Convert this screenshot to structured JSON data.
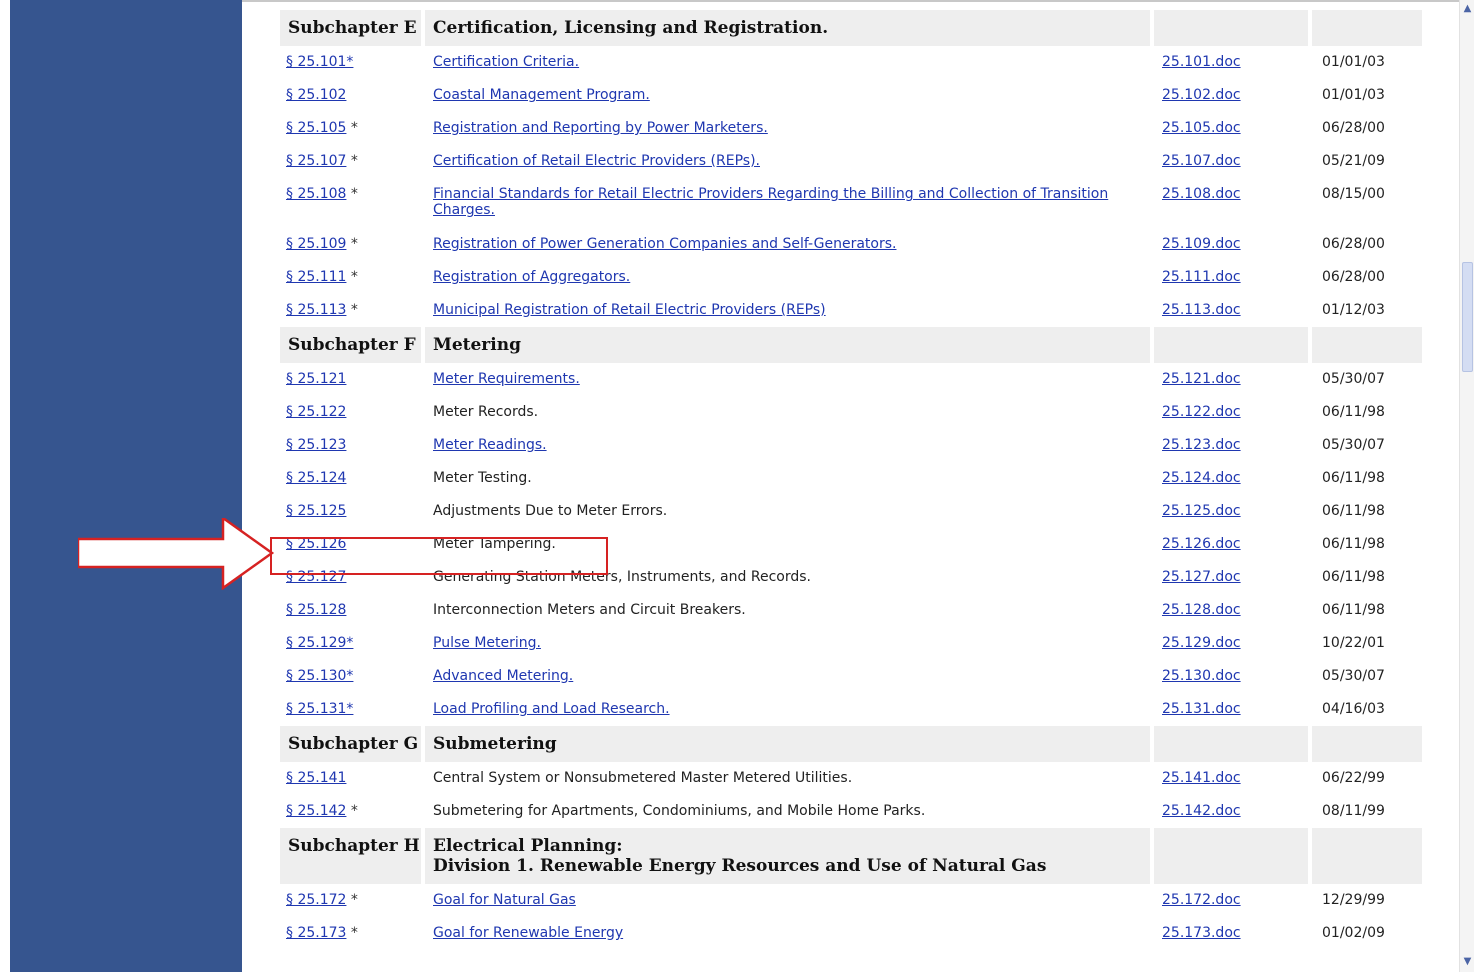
{
  "colors": {
    "sidebar": "#36558f",
    "link": "#1f37b0",
    "header_bg": "#eeeeee",
    "highlight": "#d62222"
  },
  "sections": [
    {
      "subchapter": "Subchapter E",
      "title": "Certification, Licensing and Registration.",
      "rows": [
        {
          "section": "§ 25.101*",
          "star": "",
          "title": "Certification Criteria.",
          "title_link": true,
          "doc": "25.101.doc",
          "date": "01/01/03"
        },
        {
          "section": "§ 25.102",
          "star": "",
          "title": "Coastal Management Program.",
          "title_link": true,
          "doc": "25.102.doc",
          "date": "01/01/03"
        },
        {
          "section": "§ 25.105",
          "star": " *",
          "title": "Registration and Reporting by Power Marketers.",
          "title_link": true,
          "doc": "25.105.doc",
          "date": "06/28/00"
        },
        {
          "section": "§ 25.107",
          "star": " *",
          "title": "Certification of Retail Electric Providers (REPs).",
          "title_link": true,
          "doc": "25.107.doc",
          "date": "05/21/09"
        },
        {
          "section": "§ 25.108",
          "star": " *",
          "title": "Financial Standards for Retail Electric Providers Regarding the Billing and Collection of Transition Charges.",
          "title_link": true,
          "doc": "25.108.doc",
          "date": "08/15/00"
        },
        {
          "section": "§ 25.109",
          "star": " *",
          "title": "Registration of Power Generation Companies and Self-Generators.",
          "title_link": true,
          "doc": "25.109.doc",
          "date": "06/28/00"
        },
        {
          "section": "§ 25.111",
          "star": " *",
          "title": "Registration of Aggregators.",
          "title_link": true,
          "doc": "25.111.doc",
          "date": "06/28/00"
        },
        {
          "section": "§ 25.113",
          "star": " *",
          "title": "Municipal Registration of Retail Electric Providers (REPs)",
          "title_link": true,
          "doc": "25.113.doc",
          "date": "01/12/03"
        }
      ]
    },
    {
      "subchapter": "Subchapter F",
      "title": "Metering",
      "rows": [
        {
          "section": "§ 25.121",
          "star": "",
          "title": "Meter Requirements.",
          "title_link": true,
          "doc": "25.121.doc",
          "date": "05/30/07"
        },
        {
          "section": "§ 25.122",
          "star": "",
          "title": "Meter Records.",
          "title_link": false,
          "doc": "25.122.doc",
          "date": "06/11/98"
        },
        {
          "section": "§ 25.123",
          "star": "",
          "title": "Meter Readings.",
          "title_link": true,
          "doc": "25.123.doc",
          "date": "05/30/07"
        },
        {
          "section": "§ 25.124",
          "star": "",
          "title": "Meter Testing.",
          "title_link": false,
          "doc": "25.124.doc",
          "date": "06/11/98"
        },
        {
          "section": "§ 25.125",
          "star": "",
          "title": "Adjustments Due to Meter Errors.",
          "title_link": false,
          "doc": "25.125.doc",
          "date": "06/11/98"
        },
        {
          "section": "§ 25.126",
          "star": "",
          "title": "Meter Tampering.",
          "title_link": false,
          "doc": "25.126.doc",
          "date": "06/11/98"
        },
        {
          "section": "§ 25.127",
          "star": "",
          "title": "Generating Station Meters, Instruments, and Records.",
          "title_link": false,
          "doc": "25.127.doc",
          "date": "06/11/98"
        },
        {
          "section": "§ 25.128",
          "star": "",
          "title": "Interconnection Meters and Circuit Breakers.",
          "title_link": false,
          "doc": "25.128.doc",
          "date": "06/11/98"
        },
        {
          "section": "§ 25.129*",
          "star": "",
          "title": "Pulse Metering.",
          "title_link": true,
          "doc": "25.129.doc",
          "date": "10/22/01"
        },
        {
          "section": "§ 25.130*",
          "star": "",
          "title": "Advanced Metering.",
          "title_link": true,
          "doc": "25.130.doc",
          "date": "05/30/07"
        },
        {
          "section": "§ 25.131*",
          "star": "",
          "title": "Load Profiling and Load Research.",
          "title_link": true,
          "doc": "25.131.doc",
          "date": "04/16/03"
        }
      ]
    },
    {
      "subchapter": "Subchapter G",
      "title": "Submetering",
      "rows": [
        {
          "section": "§ 25.141",
          "star": "",
          "title": "Central System or Nonsubmetered Master Metered Utilities.",
          "title_link": false,
          "doc": "25.141.doc",
          "date": "06/22/99"
        },
        {
          "section": "§ 25.142",
          "star": " *",
          "title": "Submetering for Apartments, Condominiums, and Mobile Home Parks.",
          "title_link": false,
          "doc": "25.142.doc",
          "date": "08/11/99"
        }
      ]
    },
    {
      "subchapter": "Subchapter H",
      "title": "Electrical Planning:",
      "title2": "Division 1. Renewable Energy Resources and Use of Natural Gas",
      "rows": [
        {
          "section": "§ 25.172",
          "star": " *",
          "title": "Goal for Natural Gas",
          "title_link": true,
          "doc": "25.172.doc",
          "date": "12/29/99"
        },
        {
          "section": "§ 25.173",
          "star": " *",
          "title": "Goal for Renewable Energy",
          "title_link": true,
          "doc": "25.173.doc",
          "date": "01/02/09"
        }
      ]
    }
  ]
}
